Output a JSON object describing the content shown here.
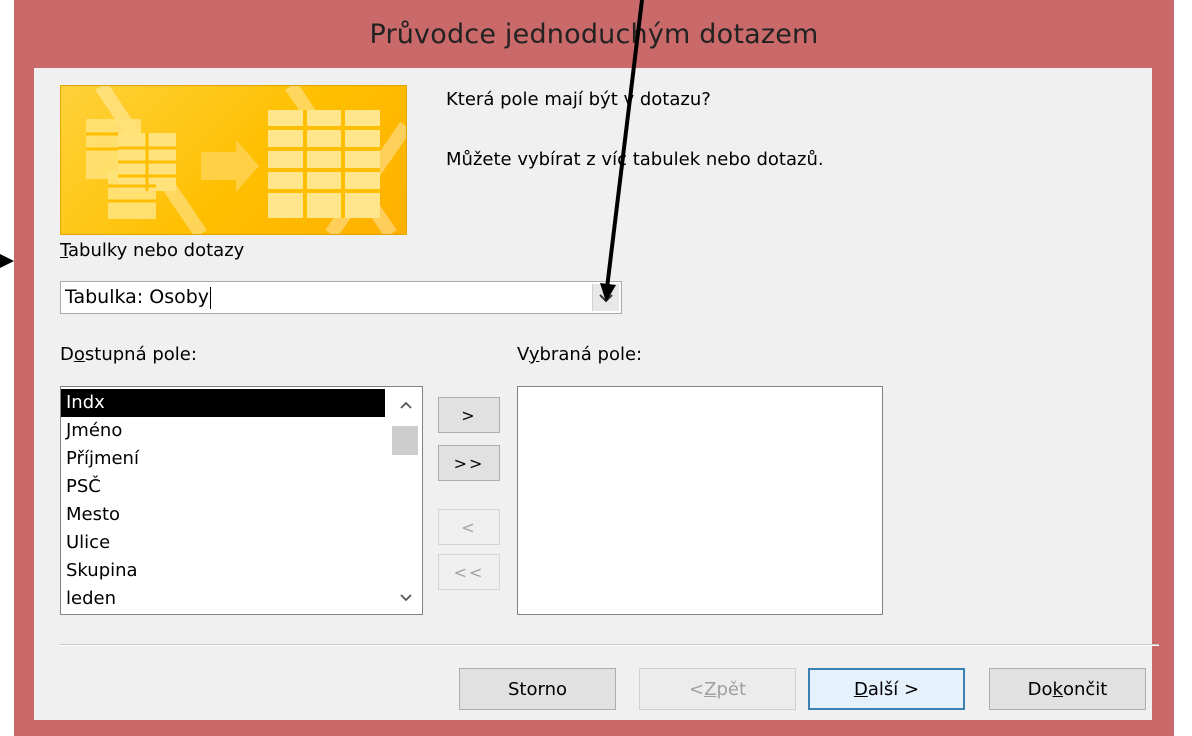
{
  "window": {
    "title": "Průvodce jednoduchým dotazem",
    "frame_color": "#c96969"
  },
  "intro": {
    "line1": "Která pole mají být v dotazu?",
    "line2": "Můžete vybírat z víc tabulek nebo dotazů."
  },
  "source": {
    "label_key": "T",
    "label_rest": "abulky nebo dotazy",
    "value": "Tabulka: Osoby",
    "dropdown_icon": "chevron-down-icon"
  },
  "available": {
    "label_pre": "D",
    "label_key": "o",
    "label_rest": "stupná pole:",
    "items": [
      "Indx",
      "Jméno",
      "Příjmení",
      "PSČ",
      "Mesto",
      "Ulice",
      "Skupina",
      "leden"
    ],
    "selected_index": 0
  },
  "selected": {
    "label_pre": "V",
    "label_key": "y",
    "label_rest": "braná pole:"
  },
  "move_buttons": {
    "add_one": ">",
    "add_all": ">>",
    "remove_one": "<",
    "remove_all": "<<"
  },
  "footer": {
    "cancel": "Storno",
    "back_pre": "< ",
    "back_key": "Z",
    "back_rest": "pět",
    "next_key": "D",
    "next_rest": "alší >",
    "finish_pre": "Do",
    "finish_key": "k",
    "finish_rest": "ončit"
  },
  "colors": {
    "accent": "#3c7fb1",
    "banner": "#ffbf00"
  }
}
